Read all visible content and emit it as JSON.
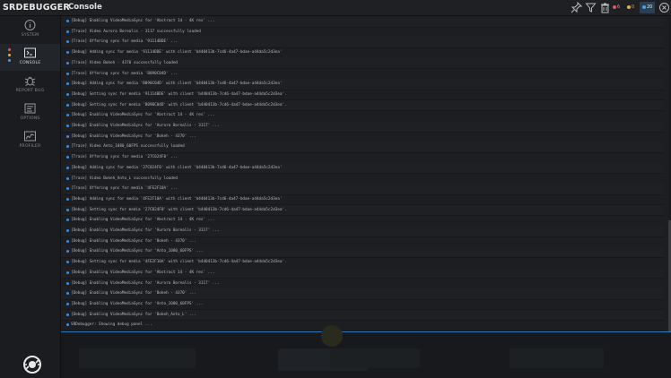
{
  "header": {
    "logo": "SRDEBUGGER",
    "title": "Console",
    "counters": [
      {
        "count": "6",
        "color": "#e05a5a"
      },
      {
        "count": "0",
        "color": "#e0b43a"
      },
      {
        "count": "20",
        "color": "#4a9fe8"
      }
    ]
  },
  "sidebar": {
    "items": [
      {
        "label": "SYSTEM",
        "icon": "info-icon"
      },
      {
        "label": "CONSOLE",
        "icon": "console-icon"
      },
      {
        "label": "REPORT BUG",
        "icon": "bug-icon"
      },
      {
        "label": "OPTIONS",
        "icon": "options-icon"
      },
      {
        "label": "PROFILER",
        "icon": "profiler-icon"
      }
    ]
  },
  "console": {
    "rows": [
      {
        "text": "[Debug] Enabling VideoMediaSync for 'Abstract 14 - 4K res' ..."
      },
      {
        "text": "[Trace] Video Aurora Borealis - 3117 successfully loaded"
      },
      {
        "text": "[Trace] Offering sync for media '91114BDE' ..."
      },
      {
        "text": "[Debug] Adding sync for media '91114BDE' with client 'b440413b-7cd6-4a47-bdae-a44da5c2d3ea'"
      },
      {
        "text": "[Trace] Video Bokeh - 4370 successfully loaded"
      },
      {
        "text": "[Trace] Offering sync for media 'B090C04D' ..."
      },
      {
        "text": "[Debug] Adding sync for media 'B090C04D' with client 'b440413b-7cd6-4a47-bdae-a44da5c2d3ea'"
      },
      {
        "text": "[Debug] Setting sync for media '91114BDE' with client 'b440413b-7cd6-4a47-bdae-a44da5c2d3ea'."
      },
      {
        "text": "[Debug] Setting sync for media 'B090C04D' with client 'b440413b-7cd6-4a47-bdae-a44da5c2d3ea'."
      },
      {
        "text": "[Debug] Enabling VideoMediaSync for 'Abstract 14 - 4K res' ..."
      },
      {
        "text": "[Debug] Enabling VideoMediaSync for 'Aurora Borealis - 3117' ..."
      },
      {
        "text": "[Debug] Enabling VideoMediaSync for 'Bokeh - 4370' ..."
      },
      {
        "text": "[Trace] Video Anto_1080_60FPS successfully loaded"
      },
      {
        "text": "[Trace] Offering sync for media '27C024F0' ..."
      },
      {
        "text": "[Debug] Adding sync for media '27C024F0' with client 'b440413b-7cd6-4a47-bdae-a44da5c2d3ea'"
      },
      {
        "text": "[Trace] Video Bokeh_Anto_L successfully loaded"
      },
      {
        "text": "[Trace] Offering sync for media '4FE2F10A' ..."
      },
      {
        "text": "[Debug] Adding sync for media '4FE2F10A' with client 'b440413b-7cd6-4a47-bdae-a44da5c2d3ea'"
      },
      {
        "text": "[Debug] Setting sync for media '27C024F0' with client 'b440413b-7cd6-4a47-bdae-a44da5c2d3ea'."
      },
      {
        "text": "[Debug] Enabling VideoMediaSync for 'Abstract 14 - 4K res' ..."
      },
      {
        "text": "[Debug] Enabling VideoMediaSync for 'Aurora Borealis - 3117' ..."
      },
      {
        "text": "[Debug] Enabling VideoMediaSync for 'Bokeh - 4370' ..."
      },
      {
        "text": "[Debug] Enabling VideoMediaSync for 'Anto_1080_60FPS' ..."
      },
      {
        "text": "[Debug] Setting sync for media '4FE2F10A' with client 'b440413b-7cd6-4a47-bdae-a44da5c2d3ea'."
      },
      {
        "text": "[Debug] Enabling VideoMediaSync for 'Abstract 14 - 4K res' ..."
      },
      {
        "text": "[Debug] Enabling VideoMediaSync for 'Aurora Borealis - 3117' ..."
      },
      {
        "text": "[Debug] Enabling VideoMediaSync for 'Bokeh - 4370' ..."
      },
      {
        "text": "[Debug] Enabling VideoMediaSync for 'Anto_1080_60FPS' ..."
      },
      {
        "text": "[Debug] Enabling VideoMediaSync for 'Bokeh_Anto_L' ..."
      },
      {
        "text": "SRDebugger: Showing debug panel ..."
      }
    ]
  }
}
